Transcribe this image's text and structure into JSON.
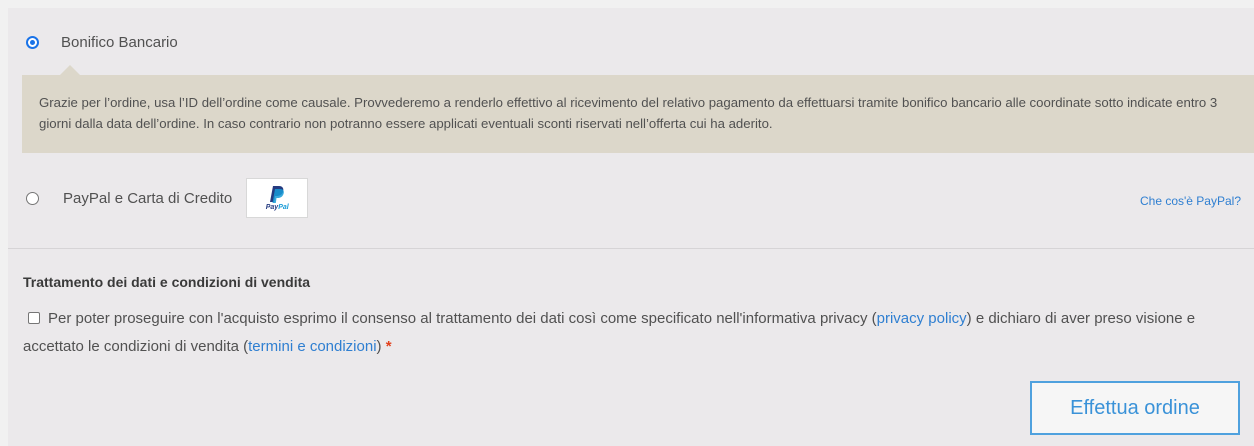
{
  "payment_methods": {
    "bacs": {
      "label": "Bonifico Bancario",
      "selected": true,
      "description": "Grazie per l’ordine, usa l’ID dell’ordine come causale. Provvederemo a renderlo effettivo al ricevimento del relativo pagamento da effettuarsi tramite bonifico bancario alle coordinate sotto indicate entro 3 giorni dalla data dell’ordine. In caso contrario non potranno essere applicati eventuali sconti riservati nell’offerta cui ha aderito."
    },
    "paypal": {
      "label": "PayPal e Carta di Credito",
      "selected": false,
      "logo_text_pay": "Pay",
      "logo_text_pal": "Pal",
      "what_is_link": "Che cos'è PayPal?"
    }
  },
  "terms": {
    "title": "Trattamento dei dati e condizioni di vendita",
    "checked": false,
    "text_part1": "Per poter proseguire con l'acquisto esprimo il consenso al trattamento dei dati così come specificato nell'informativa privacy (",
    "privacy_link": "privacy policy",
    "text_part2": ") e dichiaro di aver preso visione e accettato le condizioni di vendita (",
    "terms_link": "termini e condizioni",
    "text_part3": ")",
    "required_marker": "*"
  },
  "place_order_button": "Effettua ordine",
  "colors": {
    "accent": "#2f7fd1",
    "panel_bg": "#ebe9eb",
    "notice_bg": "#dcd7ca",
    "required": "#e2401c"
  },
  "icons": {
    "paypal_logo": "paypal-logo-icon"
  }
}
